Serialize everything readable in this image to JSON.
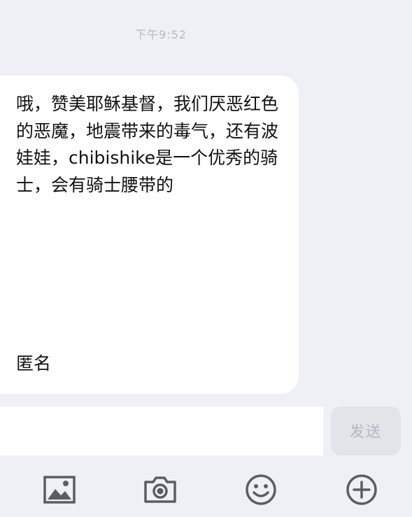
{
  "chat": {
    "timestamp": "下午9:52",
    "message": {
      "text": "哦，赞美耶稣基督，我们厌恶红色的恶魔，地震带来的毒气，还有波娃娃，chibishike是一个优秀的骑士，会有骑士腰带的",
      "signature": "匿名"
    }
  },
  "composer": {
    "input_value": "",
    "send_label": "发送"
  },
  "toolbar": {
    "icons": [
      "image-icon",
      "camera-icon",
      "emoji-icon",
      "add-icon"
    ],
    "icon_color": "#5c5d63"
  }
}
